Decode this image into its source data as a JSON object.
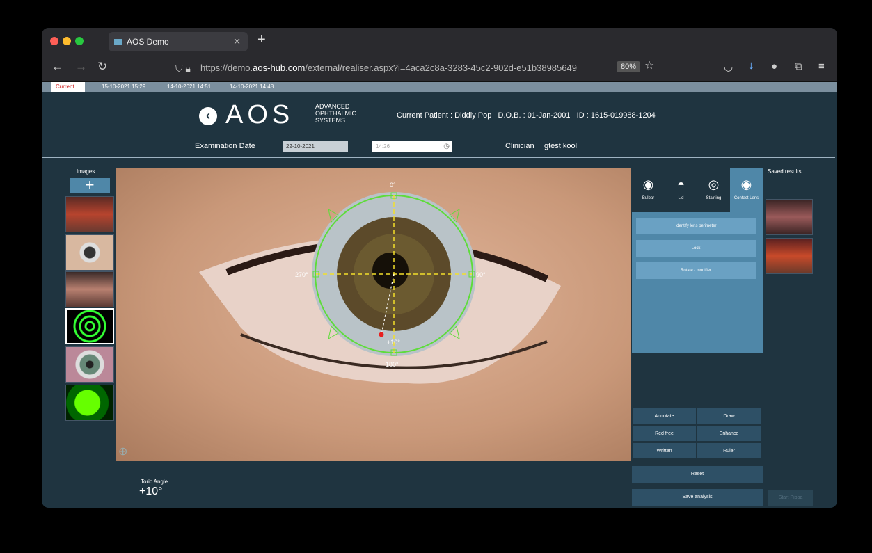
{
  "browser": {
    "tab_title": "AOS Demo",
    "url_prefix": "https://demo.",
    "url_host": "aos-hub.com",
    "url_path": "/external/realiser.aspx?i=4aca2c8a-3283-45c2-902d-e51b38985649",
    "zoom": "80%"
  },
  "app_tabs": [
    "Current",
    "15-10-2021 15:29",
    "14-10-2021 14:51",
    "14-10-2021 14:48"
  ],
  "header": {
    "logo": "AOS",
    "logo_sub": "ADVANCED OPHTHALMIC SYSTEMS",
    "patient_label": "Current Patient : Diddly Pop",
    "dob": "D.O.B. : 01-Jan-2001",
    "id": "ID : 1615-019988-1204"
  },
  "exam": {
    "date_label": "Examination Date",
    "date_value": "22-10-2021",
    "time_placeholder": "14:26",
    "clinician_label": "Clinician",
    "clinician_value": "gtest kool"
  },
  "images_label": "Images",
  "add_label": "+",
  "overlay": {
    "top": "0°",
    "right": "90°",
    "left": "270°",
    "bottom": "180°",
    "marker": "+10°"
  },
  "tools": {
    "bulbar": "Bulbar",
    "lid": "Lid",
    "staining": "Staining",
    "contact_lens": "Contact Lens"
  },
  "actions": {
    "identify": "Identify lens perimeter",
    "lock": "Lock",
    "rotate": "Rotate / modifier"
  },
  "edit": {
    "annotate": "Annotate",
    "draw": "Draw",
    "red_free": "Red free",
    "enhance": "Enhance",
    "written": "Written",
    "ruler": "Ruler",
    "reset": "Reset",
    "save_analysis": "Save analysis"
  },
  "saved_label": "Saved results",
  "start_label": "Start Pippa",
  "toric": {
    "label": "Toric Angle",
    "value": "+10°"
  },
  "colors": {
    "accent": "#4f87a8",
    "bg": "#1f3440",
    "overlay": "#5edc3a"
  }
}
